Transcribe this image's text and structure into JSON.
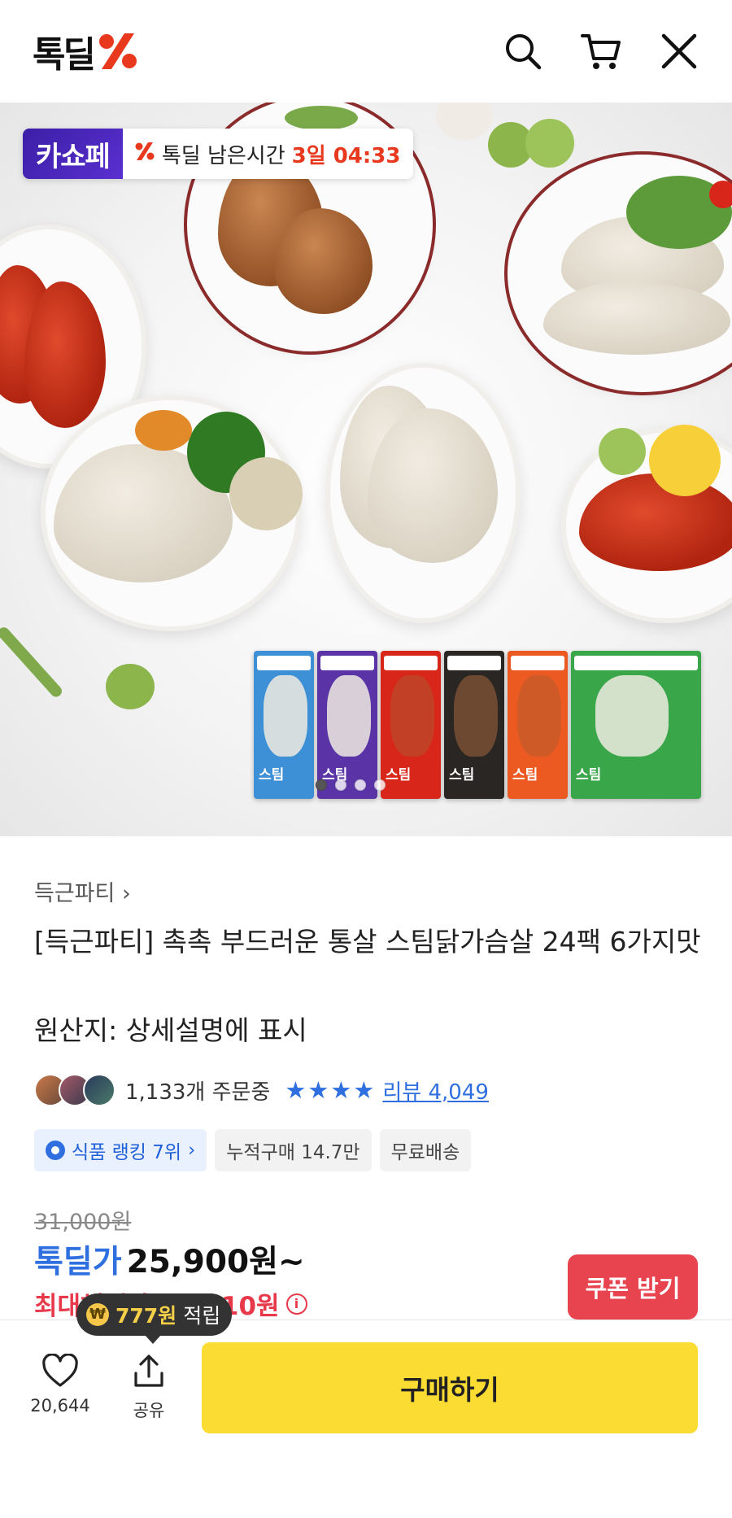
{
  "header": {
    "logo_text": "톡딜",
    "icons": [
      "search-icon",
      "cart-icon",
      "close-icon"
    ]
  },
  "hero": {
    "badge_brand": "카쇼페",
    "badge_text": "톡딜 남은시간",
    "badge_time": "3일 04:33",
    "pack_word": "스팀",
    "carousel_pages": 4,
    "carousel_active": 1
  },
  "product": {
    "seller": "득근파티",
    "title": "[득근파티] 촉촉 부드러운 통살 스팀닭가슴살 24팩 6가지맛",
    "origin": "원산지: 상세설명에 표시",
    "orders": "1,133개 주문중",
    "rating_stars": 4,
    "review_label": "리뷰 4,049",
    "chips": {
      "rank": "식품 랭킹 7위",
      "cumulative": "누적구매 14.7만",
      "shipping": "무료배송"
    },
    "original_price": "31,000원",
    "deal_label": "톡딜가",
    "deal_price": "25,900원~",
    "max_benefit": "최대혜택가 19,210원"
  },
  "coupon": {
    "label": "쿠폰 받기"
  },
  "bottom": {
    "tooltip_amount": "777원",
    "tooltip_suffix": "적립",
    "like_count": "20,644",
    "share_label": "공유",
    "buy_label": "구매하기"
  },
  "colors": {
    "accent_blue": "#2f6fe0",
    "accent_red": "#e8394b",
    "buy_yellow": "#fbdc33",
    "kaso_purple": "#3b1fa6"
  }
}
